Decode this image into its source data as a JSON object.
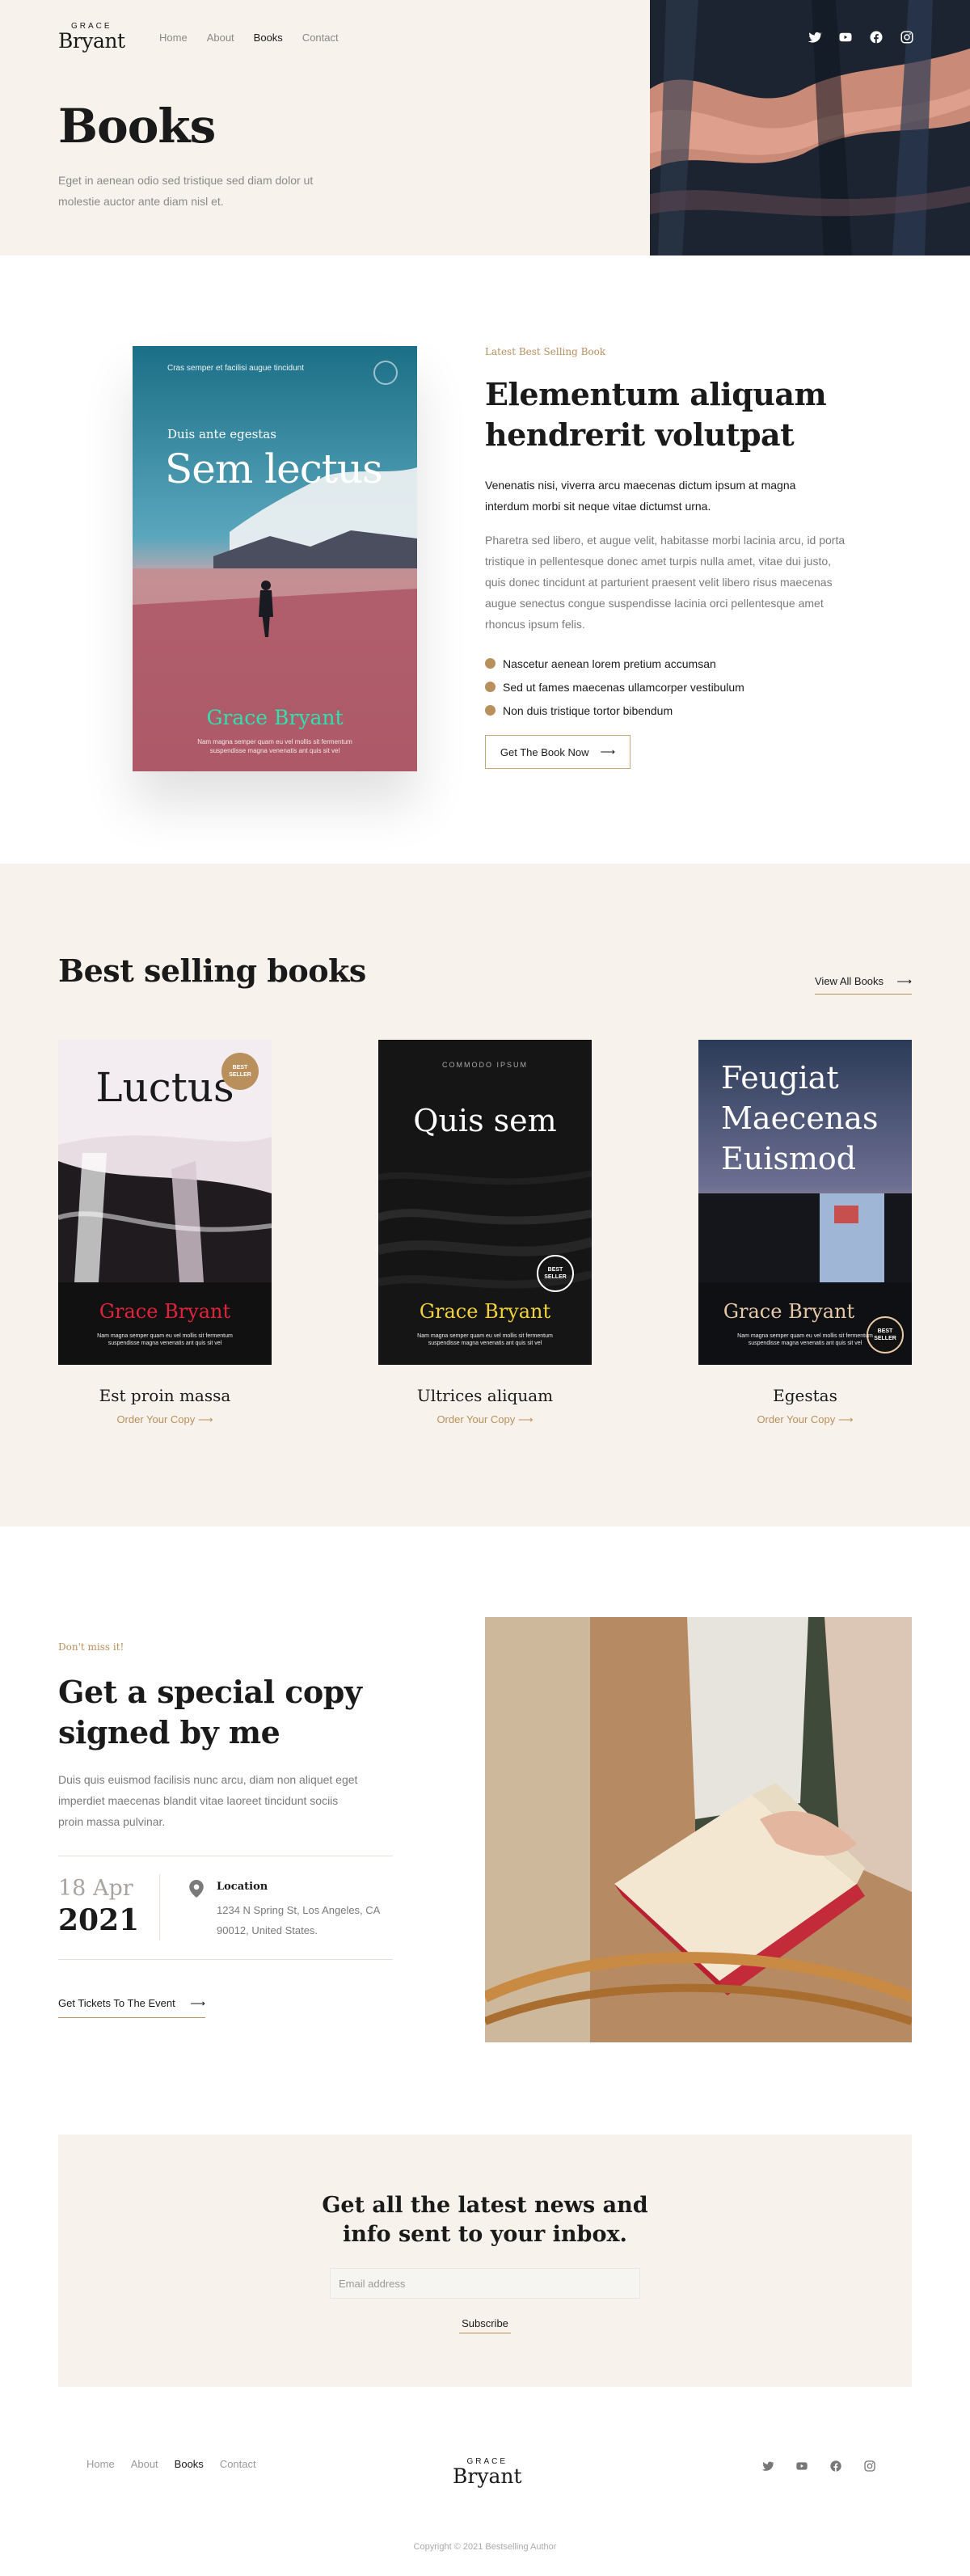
{
  "header": {
    "logo_small": "GRACE",
    "logo_big": "Bryant",
    "nav": [
      "Home",
      "About",
      "Books",
      "Contact"
    ],
    "nav_active": "Books",
    "social_icons": [
      "twitter-icon",
      "youtube-icon",
      "facebook-icon",
      "instagram-icon"
    ]
  },
  "hero": {
    "title": "Books",
    "subtitle": "Eget in aenean odio sed tristique sed diam dolor ut molestie auctor ante diam nisl et."
  },
  "featured": {
    "cover": {
      "top_text": "Cras semper et facilisi augue tincidunt",
      "kicker": "Duis ante egestas",
      "title": "Sem lectus",
      "author": "Grace Bryant",
      "blurb": "Nam magna semper quam eu vel mollis sit fermentum suspendisse magna venenatis ant quis sit vel"
    },
    "kicker": "Latest Best Selling Book",
    "title": "Elementum aliquam hendrerit volutpat",
    "lead": "Venenatis nisi, viverra arcu maecenas dictum ipsum at magna interdum morbi sit neque vitae dictumst urna.",
    "body": "Pharetra sed libero, et augue velit, habitasse morbi lacinia arcu, id porta tristique in pellentesque donec amet turpis nulla amet, vitae dui justo, quis donec tincidunt at parturient praesent velit libero risus maecenas augue senectus congue suspendisse lacinia orci pellentesque amet rhoncus ipsum felis.",
    "bullets": [
      "Nascetur aenean lorem pretium accumsan",
      "Sed ut fames maecenas ullamcorper vestibulum",
      "Non duis tristique tortor bibendum"
    ],
    "button": "Get The Book Now",
    "accent_color": "#b98f5c"
  },
  "best_selling": {
    "title": "Best selling books",
    "view_all": "View All Books",
    "books": [
      {
        "cover_title": "Luctus",
        "cover_author": "Grace Bryant",
        "badge": "BEST SELLER",
        "blurb": "Nam magna semper quam eu vel mollis sit fermentum suspendisse magna venenatis ant quis sit vel",
        "name": "Est proin massa",
        "order": "Order Your Copy",
        "author_color": "#e0243c"
      },
      {
        "cover_kicker": "COMMODO IPSUM",
        "cover_title": "Quis sem",
        "cover_author": "Grace Bryant",
        "badge": "BEST SELLER",
        "blurb": "Nam magna semper quam eu vel mollis sit fermentum suspendisse magna venenatis ant quis sit vel",
        "name": "Ultrices aliquam",
        "order": "Order Your Copy",
        "author_color": "#f2d23a"
      },
      {
        "cover_title": "Feugiat Maecenas Euismod",
        "cover_author": "Grace Bryant",
        "badge": "BEST SELLER",
        "blurb": "Nam magna semper quam eu vel mollis sit fermentum suspendisse magna venenatis ant quis sit vel",
        "name": "Egestas",
        "order": "Order Your Copy",
        "author_color": "#e8c9a6"
      }
    ]
  },
  "event": {
    "kicker": "Don't miss it!",
    "title": "Get a special copy signed by me",
    "body": "Duis quis euismod facilisis nunc arcu, diam non aliquet eget imperdiet maecenas blandit vitae laoreet tincidunt sociis proin massa pulvinar.",
    "date_day": "18 Apr",
    "date_year": "2021",
    "location_label": "Location",
    "location": "1234 N Spring St, Los Angeles, CA 90012, United States.",
    "button": "Get Tickets To The Event"
  },
  "newsletter": {
    "title": "Get all the latest news and info sent to your inbox.",
    "placeholder": "Email address",
    "button": "Subscribe"
  },
  "footer": {
    "nav": [
      "Home",
      "About",
      "Books",
      "Contact"
    ],
    "nav_active": "Books",
    "logo_small": "GRACE",
    "logo_big": "Bryant",
    "social_icons": [
      "twitter-icon",
      "youtube-icon",
      "facebook-icon",
      "instagram-icon"
    ],
    "copyright": "Copyright © 2021 Bestselling Author"
  }
}
